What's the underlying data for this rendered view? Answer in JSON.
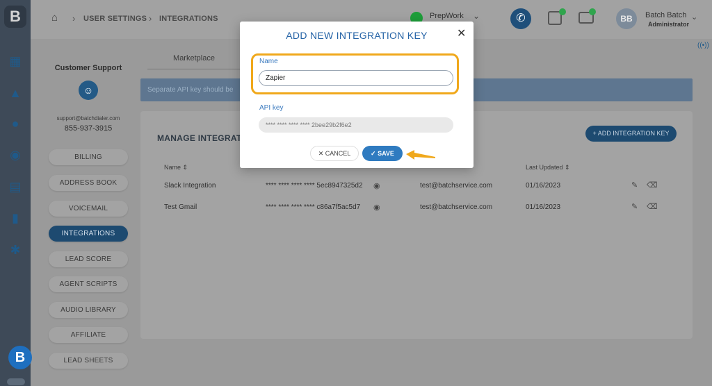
{
  "rail": {
    "logo": "B",
    "icons": [
      "dashboard-icon",
      "megaphone-icon",
      "contacts-icon",
      "headset-icon",
      "contact-list-icon",
      "stats-icon",
      "integrations-puzzle-icon"
    ],
    "bottom_logo": "B"
  },
  "topbar": {
    "breadcrumb": [
      "USER SETTINGS",
      "INTEGRATIONS"
    ],
    "workspace": "PrepWork",
    "user_initials": "BB",
    "user_name": "Batch Batch",
    "user_role": "Administrator",
    "colors": {
      "phone_button": "#1f4f7a",
      "workspace_dot": "#1e9e3a",
      "badge": "#2fa54d"
    }
  },
  "settings": {
    "title": "Customer Support",
    "email": "support@batchdialer.com",
    "phone": "855-937-3915",
    "menu": [
      {
        "label": "BILLING",
        "active": false
      },
      {
        "label": "ADDRESS BOOK",
        "active": false
      },
      {
        "label": "VOICEMAIL",
        "active": false
      },
      {
        "label": "INTEGRATIONS",
        "active": true
      },
      {
        "label": "LEAD SCORE",
        "active": false
      },
      {
        "label": "AGENT SCRIPTS",
        "active": false
      },
      {
        "label": "AUDIO LIBRARY",
        "active": false
      },
      {
        "label": "AFFILIATE",
        "active": false
      },
      {
        "label": "LEAD SHEETS",
        "active": false
      }
    ]
  },
  "main": {
    "tab": "Marketplace",
    "info_text": "Separate API key should be",
    "card_title": "MANAGE INTEGRATI",
    "add_button": "ADD INTEGRATION KEY",
    "columns": [
      "Name",
      "Last Updated"
    ],
    "rows": [
      {
        "name": "Slack Integration",
        "key": "**** **** **** **** 5ec8947325d2",
        "created_by": "test@batchservice.com",
        "updated": "01/16/2023"
      },
      {
        "name": "Test Gmail",
        "key": "**** **** **** **** c86a7f5ac5d7",
        "created_by": "test@batchservice.com",
        "updated": "01/16/2023"
      }
    ]
  },
  "modal": {
    "title": "ADD NEW INTEGRATION KEY",
    "name_label": "Name",
    "name_value": "Zapier",
    "api_label": "API key",
    "api_value": "**** **** **** **** 2bee29b2f6e2",
    "cancel_label": "CANCEL",
    "save_label": "SAVE",
    "colors": {
      "highlight": "#f0a81b",
      "accent": "#2f7bc0",
      "title": "#2563a6"
    }
  }
}
